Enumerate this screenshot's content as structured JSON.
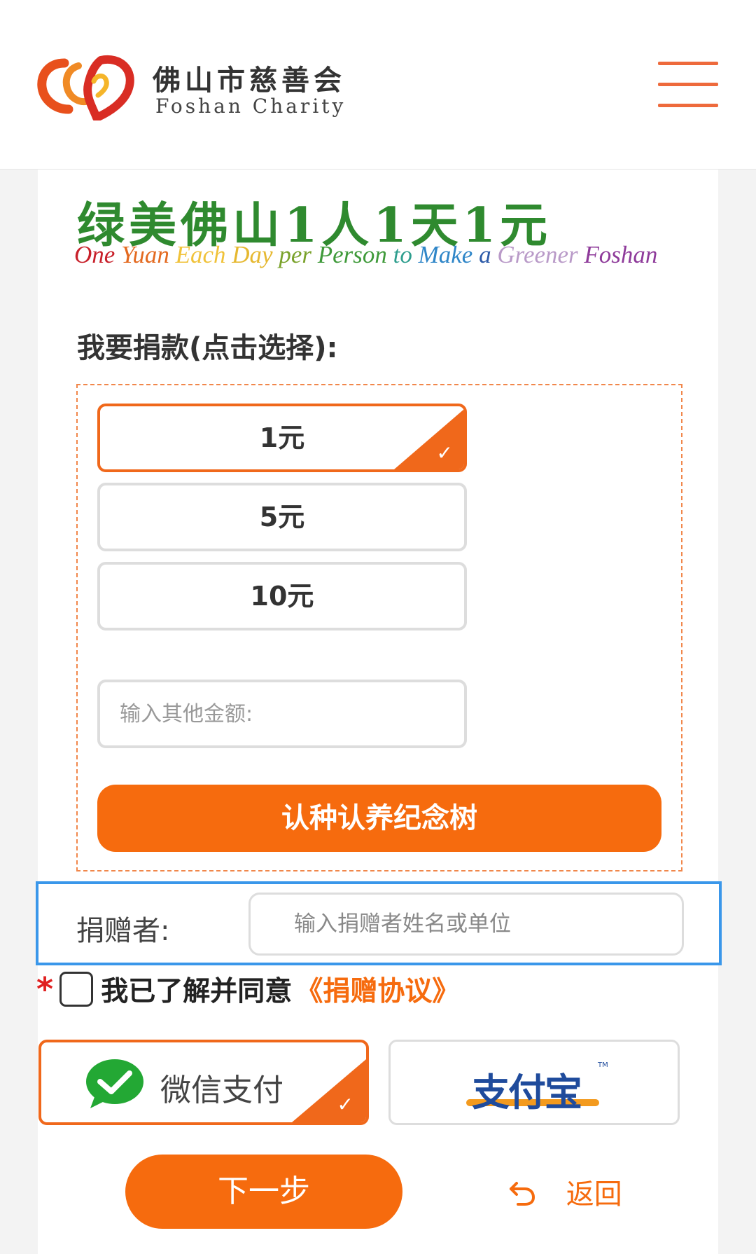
{
  "header": {
    "org_name_cn": "佛山市慈善会",
    "org_name_en": "Foshan Charity",
    "menu_icon": "hamburger-menu-icon",
    "logo_icon": "heart-rings-logo-icon"
  },
  "banner": {
    "slogan_cn": "绿美佛山1人1天1元",
    "slogan_en_words": [
      "One",
      "Yuan",
      "Each",
      "Day",
      "per",
      "Person",
      "to",
      "Make",
      "a",
      "Greener",
      "Foshan"
    ]
  },
  "donation": {
    "title": "我要捐款(点击选择):",
    "options": [
      {
        "label": "1元",
        "selected": true
      },
      {
        "label": "5元",
        "selected": false
      },
      {
        "label": "10元",
        "selected": false
      }
    ],
    "custom_amount_placeholder": "输入其他金额:",
    "check_mark": "✓",
    "tree_button_label": "认种认养纪念树"
  },
  "donor": {
    "label": "捐赠者:",
    "placeholder": "输入捐赠者姓名或单位"
  },
  "agreement": {
    "required_mark": "*",
    "text": "我已了解并同意",
    "link": "《捐赠协议》",
    "checked": false
  },
  "payment": {
    "wechat_label": "微信支付",
    "wechat_selected": true,
    "alipay_label": "支付宝",
    "alipay_tm": "TM"
  },
  "actions": {
    "next_label": "下一步",
    "back_label": "返回",
    "back_icon": "undo-arrow-icon"
  },
  "colors": {
    "accent": "#f66b0e",
    "selected_border": "#f0681b",
    "focus_outline": "#3a97ea",
    "slogan_green": "#2f8a2f",
    "required_red": "#e02020",
    "alipay_blue": "#1f4b9c"
  }
}
